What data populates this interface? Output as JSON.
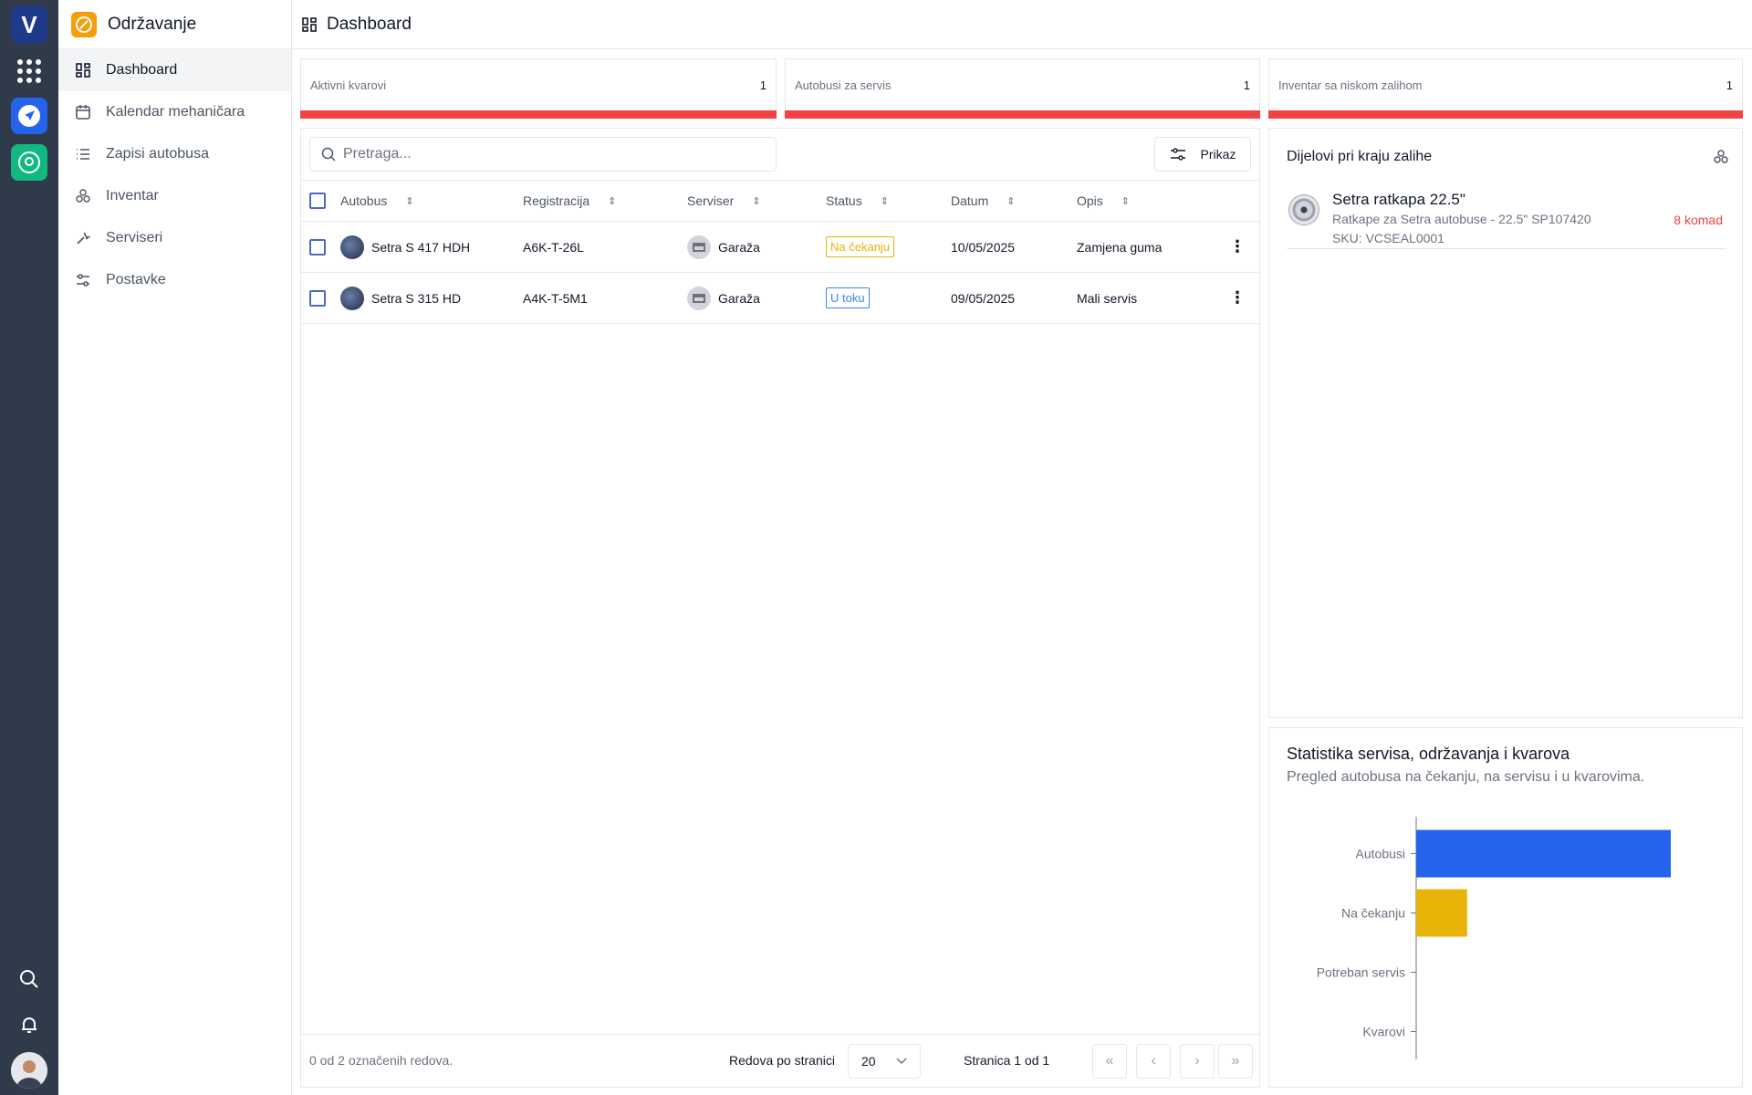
{
  "app": {
    "title": "Održavanje"
  },
  "sidebar": {
    "items": [
      {
        "label": "Dashboard",
        "icon": "dashboard-icon",
        "active": true
      },
      {
        "label": "Kalendar mehaničara",
        "icon": "calendar-icon"
      },
      {
        "label": "Zapisi autobusa",
        "icon": "list-icon"
      },
      {
        "label": "Inventar",
        "icon": "boxes-icon"
      },
      {
        "label": "Serviseri",
        "icon": "wrench-icon"
      },
      {
        "label": "Postavke",
        "icon": "sliders-icon"
      }
    ]
  },
  "header": {
    "title": "Dashboard"
  },
  "stats": [
    {
      "label": "Aktivni kvarovi",
      "value": "1"
    },
    {
      "label": "Autobusi za servis",
      "value": "1"
    },
    {
      "label": "Inventar sa niskom zalihom",
      "value": "1"
    }
  ],
  "table": {
    "search_placeholder": "Pretraga...",
    "view_button": "Prikaz",
    "columns": [
      "Autobus",
      "Registracija",
      "Serviser",
      "Status",
      "Datum",
      "Opis"
    ],
    "rows": [
      {
        "bus": "Setra S 417 HDH",
        "reg": "A6K-T-26L",
        "servicer": "Garaža",
        "status": "Na čekanju",
        "date": "10/05/2025",
        "desc": "Zamjena guma"
      },
      {
        "bus": "Setra S 315 HD",
        "reg": "A4K-T-5M1",
        "servicer": "Garaža",
        "status": "U toku",
        "date": "09/05/2025",
        "desc": "Mali servis"
      }
    ],
    "footer": {
      "selected": "0 od 2 označenih redova.",
      "rows_per_page_label": "Redova po stranici",
      "rows_per_page": "20",
      "page": "Stranica 1 od 1"
    }
  },
  "low_stock": {
    "title": "Dijelovi pri kraju zalihe",
    "items": [
      {
        "name": "Setra ratkapa 22.5\"",
        "desc": "Ratkape za Setra autobuse - 22.5\" SP107420",
        "sku": "SKU: VCSEAL0001",
        "qty": "8 komad"
      }
    ]
  },
  "stats_card": {
    "title": "Statistika servisa, održavanja i kvarova",
    "subtitle": "Pregled autobusa na čekanju, na servisu i u kvarovima."
  },
  "chart_data": {
    "type": "bar",
    "orientation": "horizontal",
    "categories": [
      "Autobusi",
      "Na čekanju",
      "Potreban servis",
      "Kvarovi"
    ],
    "values": [
      5,
      1,
      0,
      0
    ],
    "colors": [
      "#2563eb",
      "#eab308",
      "#ef4444",
      "#ef4444"
    ],
    "xlim": [
      0,
      5
    ],
    "grid": false
  }
}
